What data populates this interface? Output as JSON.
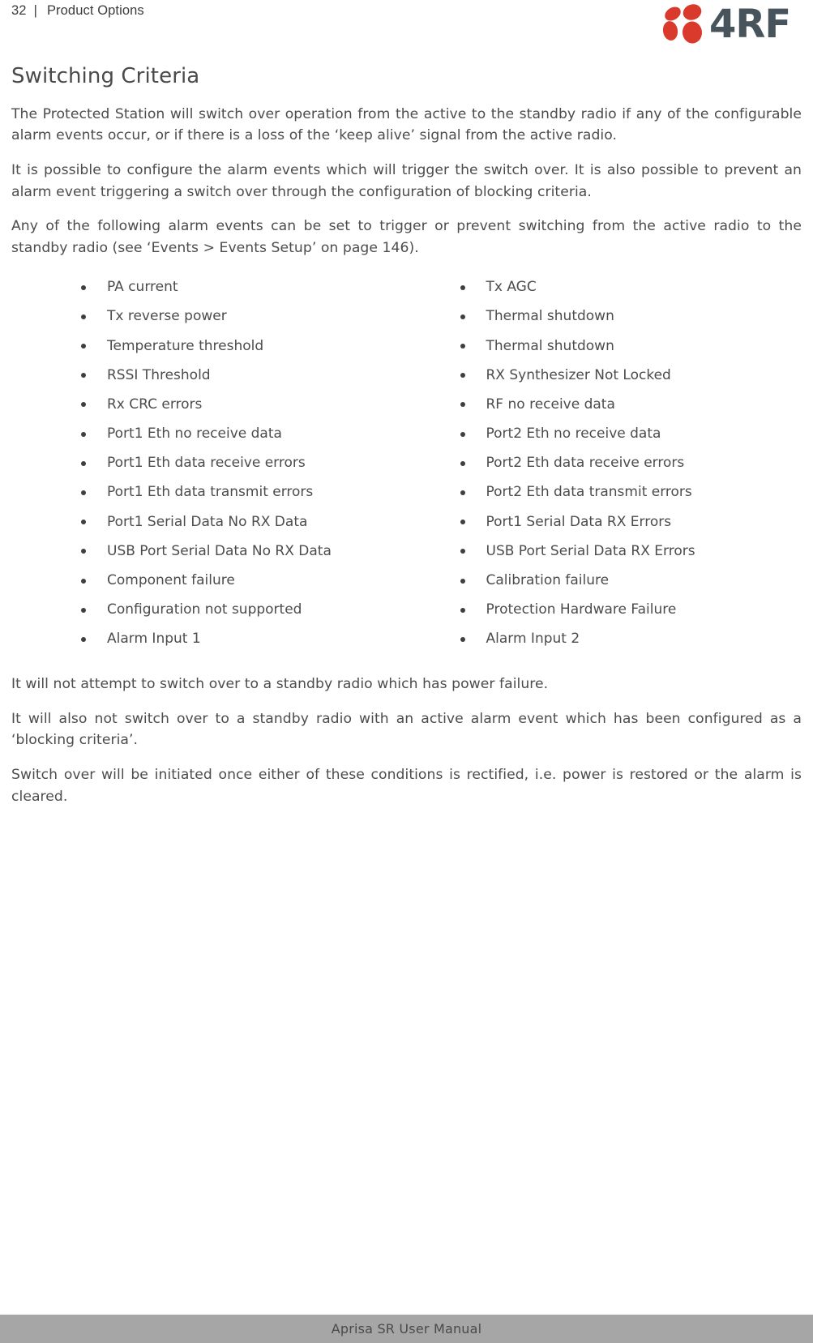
{
  "header": {
    "page_number": "32",
    "separator": "|",
    "chapter": "Product Options",
    "logo_text": "4RF",
    "logo_color": "#d93a2b",
    "logo_wordmark_color": "#47545c"
  },
  "section": {
    "title": "Switching Criteria",
    "paragraphs_before": [
      "The Protected Station will switch over operation from the active to the standby radio if any of the configurable alarm events occur, or if there is a loss of the ‘keep alive’ signal from the active radio.",
      "It is possible to configure the alarm events which will trigger the switch over. It is also possible to prevent an alarm event triggering a switch over through the configuration of blocking criteria.",
      "Any of the following alarm events can be set to trigger or prevent switching from the active radio to the standby radio (see ‘Events > Events Setup’ on page 146)."
    ],
    "alarm_events": {
      "left_column": [
        "PA current",
        "Tx reverse power",
        "Temperature threshold",
        "RSSI Threshold",
        "Rx CRC errors",
        "Port1 Eth no receive data",
        "Port1 Eth data receive errors",
        "Port1 Eth data transmit errors",
        "Port1 Serial Data No RX Data",
        "USB Port Serial Data No RX Data",
        "Component failure",
        "Configuration not supported",
        "Alarm Input 1"
      ],
      "right_column": [
        "Tx AGC",
        "Thermal shutdown",
        "Thermal shutdown",
        "RX Synthesizer Not Locked",
        "RF no receive data",
        "Port2 Eth no receive data",
        "Port2 Eth data receive errors",
        "Port2 Eth data transmit errors",
        "Port1 Serial Data RX Errors",
        "USB Port Serial Data RX Errors",
        "Calibration failure",
        "Protection Hardware Failure",
        "Alarm Input 2"
      ]
    },
    "paragraphs_after": [
      "It will not attempt to switch over to a standby radio which has power failure.",
      "It will also not switch over to a standby radio with an active alarm event which has been configured as a ‘blocking criteria’.",
      "Switch over will be initiated once either of these conditions is rectified, i.e. power is restored or the alarm is cleared."
    ]
  },
  "footer": {
    "text": "Aprisa SR User Manual"
  }
}
